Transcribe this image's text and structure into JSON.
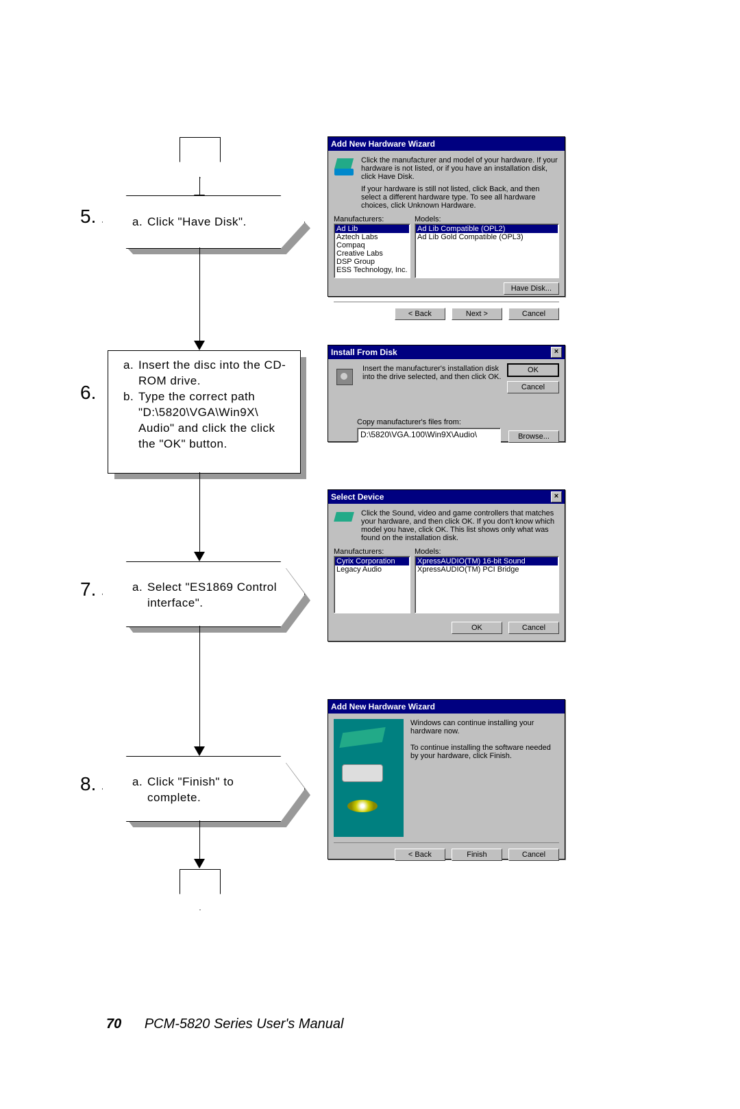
{
  "page_number": "70",
  "footer_title": "PCM-5820 Series  User's Manual",
  "steps": {
    "5": {
      "num": "5.",
      "a": "Click \"Have Disk\"."
    },
    "6": {
      "num": "6.",
      "a": "Insert the disc into the CD-ROM drive.",
      "b": "Type the correct path \"D:\\5820\\VGA\\Win9X\\ Audio\" and click the click the \"OK\" button."
    },
    "7": {
      "num": "7.",
      "a": "Select \"ES1869 Control interface\"."
    },
    "8": {
      "num": "8.",
      "a": "Click \"Finish\" to complete."
    }
  },
  "dlg1": {
    "title": "Add New Hardware Wizard",
    "instr1": "Click the manufacturer and model of your hardware. If your hardware is not listed, or if you have an installation disk, click Have Disk.",
    "instr2": "If your hardware is still not listed, click Back, and then select a different hardware type. To see all hardware choices, click Unknown Hardware.",
    "col1": "Manufacturers:",
    "col2": "Models:",
    "mfrs": [
      "Ad Lib",
      "Aztech Labs",
      "Compaq",
      "Creative Labs",
      "DSP Group",
      "ESS Technology, Inc."
    ],
    "models": [
      "Ad Lib Compatible (OPL2)",
      "Ad Lib Gold Compatible (OPL3)"
    ],
    "havedisk": "Have Disk...",
    "back": "< Back",
    "next": "Next >",
    "cancel": "Cancel"
  },
  "dlg2": {
    "title": "Install From Disk",
    "instr": "Insert the manufacturer's installation disk into the drive selected, and then click OK.",
    "copylbl": "Copy manufacturer's files from:",
    "path": "D:\\5820\\VGA.100\\Win9X\\Audio\\",
    "ok": "OK",
    "cancel": "Cancel",
    "browse": "Browse..."
  },
  "dlg3": {
    "title": "Select Device",
    "instr": "Click the Sound, video and game controllers that matches your hardware, and then click OK. If you don't know which model you have, click OK. This list shows only what was found on the installation disk.",
    "col1": "Manufacturers:",
    "col2": "Models:",
    "mfrs": [
      "Cyrix Corporation",
      "Legacy Audio"
    ],
    "models": [
      "XpressAUDIO(TM) 16-bit Sound",
      "XpressAUDIO(TM) PCI Bridge"
    ],
    "ok": "OK",
    "cancel": "Cancel"
  },
  "dlg4": {
    "title": "Add New Hardware Wizard",
    "line1": "Windows can continue installing your hardware now.",
    "line2": "To continue installing the software needed by your hardware, click Finish.",
    "back": "< Back",
    "finish": "Finish",
    "cancel": "Cancel"
  }
}
